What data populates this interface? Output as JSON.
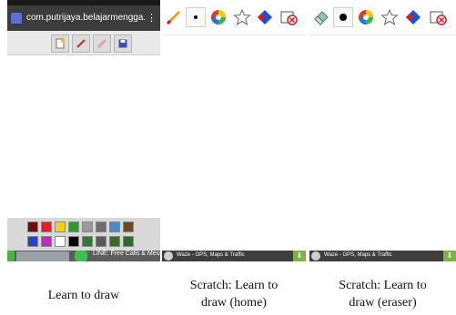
{
  "phone1": {
    "app_title": "com.putrijaya.belajarmengga...",
    "menu_glyph": "⋮",
    "toolbar_icons": [
      "new-page-icon",
      "brush-icon",
      "eraser-icon",
      "save-icon"
    ],
    "palette_row1": [
      "#6b1010",
      "#e02020",
      "#f2d21a",
      "#2c9a2c",
      "#9a9a9a",
      "#6e6e6e",
      "#4a8ac8",
      "#6b4a1e"
    ],
    "palette_row2": [
      "#2a3fd6",
      "#c42ab8",
      "#ffffff",
      "#000000",
      "#2f7a2f",
      "#5a5a5a",
      "#3a6a2a",
      "#2d6a2d"
    ],
    "ad_text": "LINE: Free Calls & Messages"
  },
  "phone2": {
    "tools": [
      "pencil-icon",
      "dot-icon",
      "color-wheel-icon",
      "star-stamp-icon",
      "fill-bucket-icon",
      "clear-icon"
    ],
    "ad_text": "Waze - GPS, Maps & Traffic",
    "download_glyph": "⬇"
  },
  "phone3": {
    "tools": [
      "eraser-icon",
      "dot-icon",
      "color-wheel-icon",
      "star-stamp-icon",
      "fill-bucket-icon",
      "clear-icon"
    ],
    "ad_text": "Waze - GPS, Maps & Traffic",
    "download_glyph": "⬇"
  },
  "captions": {
    "c1": "Learn to draw",
    "c2_line1": "Scratch: Learn to",
    "c2_line2": "draw (home)",
    "c3_line1": "Scratch: Learn to",
    "c3_line2": "draw (eraser)"
  }
}
